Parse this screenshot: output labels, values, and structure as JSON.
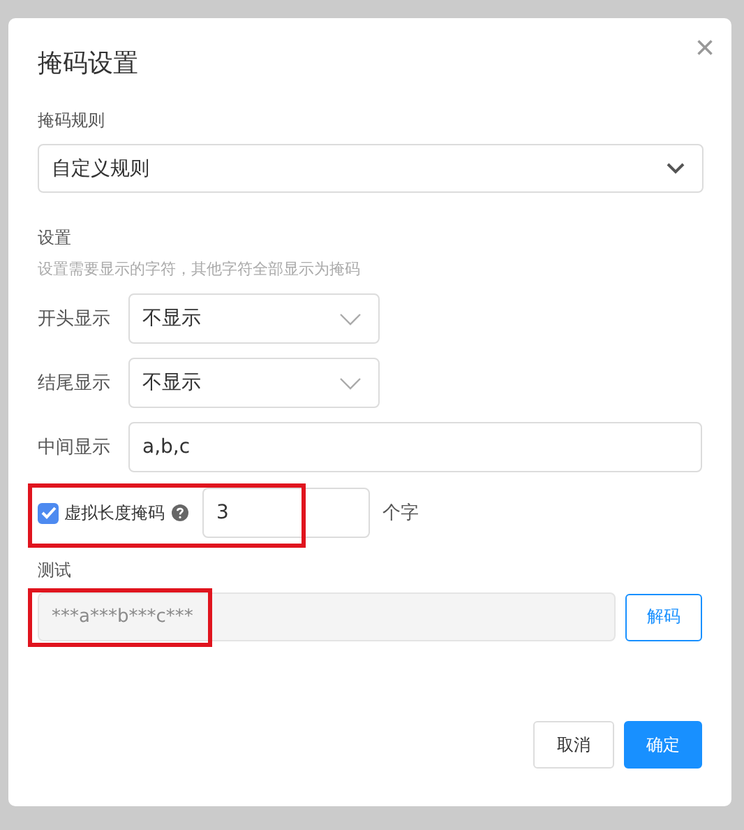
{
  "dialog": {
    "title": "掩码设置",
    "close": "×"
  },
  "rule": {
    "label": "掩码规则",
    "value": "自定义规则"
  },
  "settings": {
    "heading": "设置",
    "hint": "设置需要显示的字符，其他字符全部显示为掩码"
  },
  "rows": [
    {
      "kind": "select",
      "label": "开头显示",
      "value": "不显示"
    },
    {
      "kind": "select",
      "label": "结尾显示",
      "value": "不显示"
    },
    {
      "kind": "input",
      "label": "中间显示",
      "value": "a,b,c"
    }
  ],
  "virtual_mask": {
    "label": "虚拟长度掩码",
    "checked": true,
    "value": "3",
    "unit": "个字",
    "highlighted": true
  },
  "test": {
    "label": "测试",
    "value": "***a***b***c***",
    "disabled": true,
    "highlighted": true,
    "button": "解码"
  },
  "buttons": [
    {
      "label": "取消",
      "primary": false
    },
    {
      "label": "确定",
      "primary": true
    }
  ]
}
